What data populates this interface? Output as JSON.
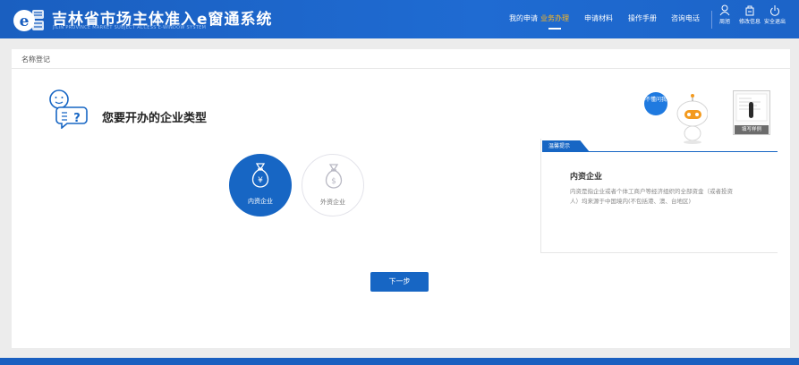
{
  "header": {
    "title": "吉林省市场主体准入e窗通系统",
    "subtitle_en": "JILIN PROVINCE MARKET SUBJECT ACCESS E-WINDOW SYSTEM",
    "logo_icon": "e-tong-logo-icon",
    "nav": [
      {
        "label": "我的申请",
        "active": false
      },
      {
        "label": "业务办理",
        "active": true
      },
      {
        "label": "申请材料",
        "active": false
      },
      {
        "label": "操作手册",
        "active": false
      },
      {
        "label": "咨询电话",
        "active": false
      }
    ],
    "utils": [
      {
        "label": "周旭",
        "icon": "user-icon"
      },
      {
        "label": "修改信息",
        "icon": "edit-info-icon"
      },
      {
        "label": "安全退出",
        "icon": "power-icon"
      }
    ],
    "active_color": "#ffb81c",
    "brand_color": "#1a5fc0"
  },
  "breadcrumb": "名称登记",
  "main": {
    "question": "您要开办的企业类型",
    "options": [
      {
        "label": "内资企业",
        "icon": "money-bag-yuan-icon",
        "selected": true
      },
      {
        "label": "外资企业",
        "icon": "money-bag-dollar-icon",
        "selected": false
      }
    ],
    "next_label": "下一步"
  },
  "robot": {
    "bubble": "不懂问我"
  },
  "sample": {
    "label": "填写样例"
  },
  "tip": {
    "tag": "温馨提示",
    "title": "内资企业",
    "body": "内资是指企业或者个体工商户等经济组织的全部资金（或者投资人）均来源于中国境内(不包括港、澳、台地区)"
  }
}
